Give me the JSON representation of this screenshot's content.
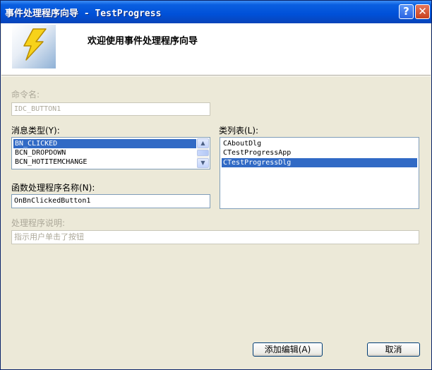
{
  "window": {
    "title": "事件处理程序向导 - TestProgress",
    "help_label": "?",
    "close_label": "✕"
  },
  "header": {
    "title": "欢迎使用事件处理程序向导",
    "icon": "lightning-bolt-icon"
  },
  "command_name": {
    "label": "命令名:",
    "value": "IDC_BUTTON1"
  },
  "message_type": {
    "label": "消息类型(Y):",
    "items": [
      "BN_CLICKED",
      "BCN_DROPDOWN",
      "BCN_HOTITEMCHANGE"
    ],
    "selected": "BN_CLICKED"
  },
  "class_list": {
    "label": "类列表(L):",
    "items": [
      "CAboutDlg",
      "CTestProgressApp",
      "CTestProgressDlg"
    ],
    "selected": "CTestProgressDlg"
  },
  "handler_name": {
    "label": "函数处理程序名称(N):",
    "value": "OnBnClickedButton1"
  },
  "handler_desc": {
    "label": "处理程序说明:",
    "value": "指示用户单击了按钮"
  },
  "buttons": {
    "add_edit": "添加编辑(A)",
    "cancel": "取消"
  },
  "colors": {
    "selection": "#316ac5",
    "title_bar": "#0050d8",
    "dialog_bg": "#ece9d8"
  }
}
